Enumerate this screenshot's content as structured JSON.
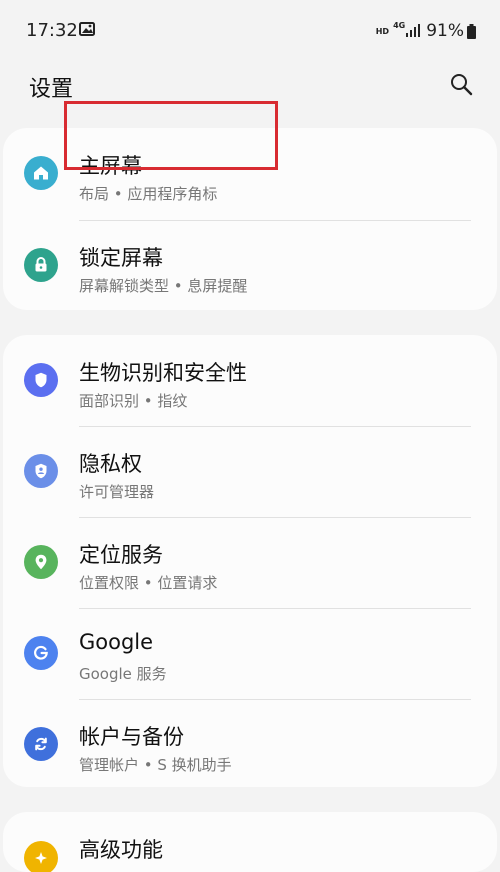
{
  "status_bar": {
    "time": "17:32",
    "hd": "HD",
    "network": "4G",
    "battery": "91%"
  },
  "header": {
    "title": "设置"
  },
  "groups": [
    {
      "items": [
        {
          "title": "主屏幕",
          "subtitle": "布局 • 应用程序角标",
          "icon": "home-icon",
          "color": "#39aecf"
        },
        {
          "title": "锁定屏幕",
          "subtitle": "屏幕解锁类型 • 息屏提醒",
          "icon": "lock-icon",
          "color": "#2ea38d"
        }
      ]
    },
    {
      "items": [
        {
          "title": "生物识别和安全性",
          "subtitle": "面部识别 • 指纹",
          "icon": "shield-icon",
          "color": "#5b6ff0"
        },
        {
          "title": "隐私权",
          "subtitle": "许可管理器",
          "icon": "privacy-icon",
          "color": "#6b8fe8"
        },
        {
          "title": "定位服务",
          "subtitle": "位置权限 • 位置请求",
          "icon": "location-icon",
          "color": "#58b45d"
        },
        {
          "title": "Google",
          "subtitle": "Google 服务",
          "icon": "google-icon",
          "color": "#4d82ef"
        },
        {
          "title": "帐户与备份",
          "subtitle": "管理帐户 • S 换机助手",
          "icon": "sync-icon",
          "color": "#3f70dc"
        }
      ]
    },
    {
      "items": [
        {
          "title": "高级功能",
          "icon": "advanced-icon",
          "color": "#f0b400"
        }
      ]
    }
  ],
  "highlight": {
    "target": "锁定屏幕",
    "color": "#d82b31"
  }
}
